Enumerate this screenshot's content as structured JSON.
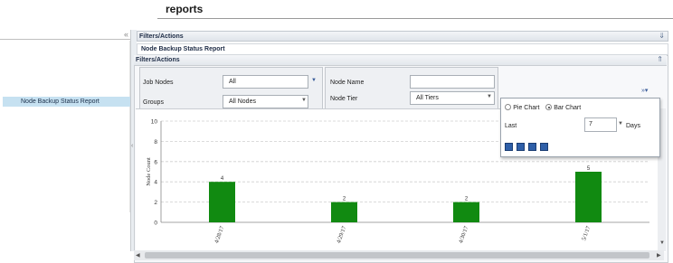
{
  "page": {
    "title": "reports"
  },
  "sidebar": {
    "items": [
      {
        "label": "Node Backup Status Report",
        "selected": true
      }
    ],
    "collapse_icon": "double-chevron-left-icon"
  },
  "filters_bar": {
    "label": "Filters/Actions",
    "icon": "double-chevron-down-icon"
  },
  "report_bar": {
    "label": "Node Backup Status Report"
  },
  "filters_panel": {
    "header": "Filters/Actions",
    "collapse_icon": "double-chevron-up-icon",
    "job_nodes": {
      "label": "Job Nodes",
      "value": "All"
    },
    "groups": {
      "label": "Groups",
      "value": "All Nodes"
    },
    "node_name": {
      "label": "Node Name",
      "value": ""
    },
    "node_tier": {
      "label": "Node Tier",
      "value": "All Tiers"
    },
    "more_icon": "double-chevron-right-icon"
  },
  "popup": {
    "pie_label": "Pie Chart",
    "bar_label": "Bar Chart",
    "selected": "Bar Chart",
    "last_label": "Last",
    "last_value": "7",
    "days_label": "Days",
    "tools": [
      "refresh-icon",
      "save-icon",
      "email-icon",
      "print-icon"
    ]
  },
  "chart_data": {
    "type": "bar",
    "categories": [
      "4/28/17",
      "4/29/17",
      "4/30/17",
      "5/1/17"
    ],
    "values": [
      4,
      2,
      2,
      5
    ],
    "ylabel": "Node Count",
    "xlabel": "",
    "ylim": [
      0,
      10
    ],
    "yticks": [
      "0",
      "2",
      "4",
      "6",
      "8",
      "10"
    ],
    "bar_color": "#118a11",
    "grid": true
  }
}
